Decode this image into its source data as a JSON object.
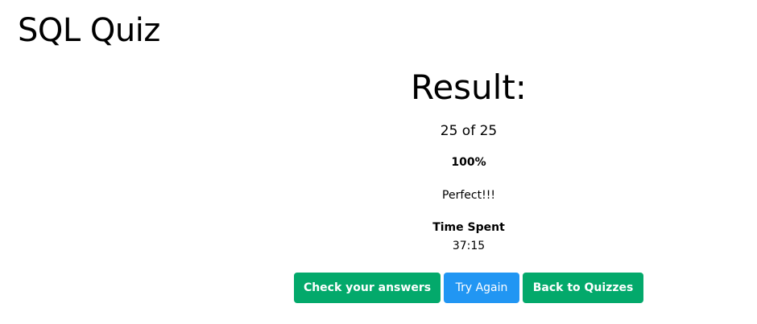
{
  "header": {
    "title": "SQL Quiz"
  },
  "result": {
    "heading": "Result:",
    "score_text": "25 of 25",
    "correct": 25,
    "total": 25,
    "percent_text": "100%",
    "message": "Perfect!!!",
    "time_label": "Time Spent",
    "time_value": "37:15"
  },
  "actions": {
    "check_answers_label": "Check your answers",
    "try_again_label": "Try Again",
    "back_label": "Back to Quizzes"
  },
  "colors": {
    "primary_green": "#03a96b",
    "primary_blue": "#2196f3",
    "text": "#000000",
    "background": "#ffffff"
  }
}
